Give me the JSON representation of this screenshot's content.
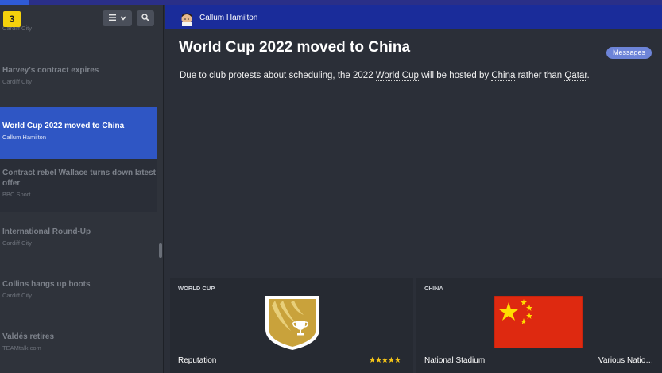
{
  "sidebar": {
    "unread_count": "3",
    "sort_icon": "sort-lines-icon",
    "search_icon": "search-icon",
    "messages": [
      {
        "title": "",
        "source": "Cardiff City",
        "state": "normal"
      },
      {
        "title": "Harvey's contract expires",
        "source": "Cardiff City",
        "state": "normal"
      },
      {
        "title": "World Cup 2022 moved to China",
        "source": "Callum Hamilton",
        "state": "active"
      },
      {
        "title": "Contract rebel Wallace turns down latest offer",
        "source": "BBC Sport",
        "state": "dark"
      },
      {
        "title": "International Round-Up",
        "source": "Cardiff City",
        "state": "normal"
      },
      {
        "title": "Collins hangs up boots",
        "source": "Cardiff City",
        "state": "normal"
      },
      {
        "title": "Valdés retires",
        "source": "TEAMtalk.com",
        "state": "normal"
      }
    ]
  },
  "header": {
    "sender": "Callum Hamilton"
  },
  "message": {
    "title": "World Cup 2022 moved to China",
    "messages_button": "Messages",
    "body_prefix": "Due to club protests about scheduling, the 2022 ",
    "link_world_cup": "World Cup",
    "body_mid": " will be hosted by ",
    "link_china": "China",
    "body_mid2": " rather than ",
    "link_qatar": "Qatar",
    "body_suffix": "."
  },
  "cards": {
    "world_cup": {
      "label": "WORLD CUP",
      "stat_label": "Reputation",
      "stars": "★★★★★",
      "rating": 5
    },
    "china": {
      "label": "CHINA",
      "stadium_label": "National Stadium",
      "stadium_value": "Various Natio…"
    }
  },
  "colors": {
    "accent_blue": "#2f56c4",
    "header_blue": "#1a2c9a",
    "badge_yellow": "#f5d20c",
    "star_gold": "#f5c518",
    "wc_gold": "#c9a23b",
    "china_red": "#de2910"
  }
}
